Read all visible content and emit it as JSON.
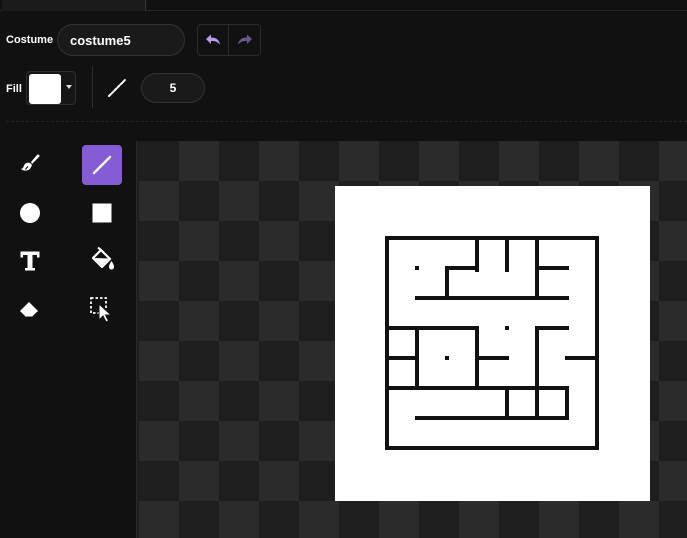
{
  "header": {
    "costume_label": "Costume",
    "costume_name": "costume5"
  },
  "fill": {
    "label": "Fill",
    "color": "#ffffff"
  },
  "outline": {
    "width": "5"
  },
  "toolbar": {
    "active_tool": "line",
    "active_color": "#855cd6",
    "tools": [
      "brush",
      "line",
      "circle",
      "rectangle",
      "text",
      "fill",
      "eraser",
      "select"
    ]
  },
  "canvas": {
    "background": "checkerboard",
    "costume_background": "#ffffff",
    "art": "maze"
  }
}
